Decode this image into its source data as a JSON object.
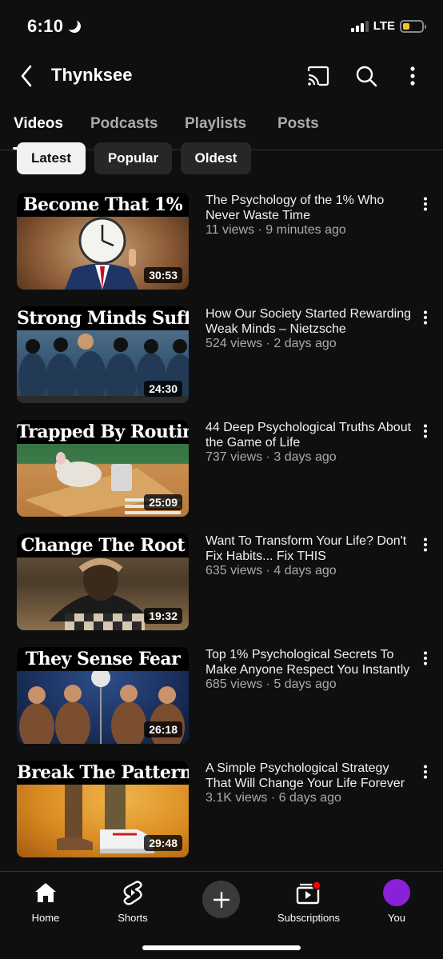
{
  "status_bar": {
    "time": "6:10",
    "network": "LTE",
    "battery_percent": 35
  },
  "header": {
    "channel_name": "Thynksee"
  },
  "tabs": [
    {
      "label": "Videos",
      "active": true
    },
    {
      "label": "Podcasts",
      "active": false
    },
    {
      "label": "Playlists",
      "active": false
    },
    {
      "label": "Posts",
      "active": false
    }
  ],
  "chips": [
    {
      "label": "Latest",
      "active": true
    },
    {
      "label": "Popular",
      "active": false
    },
    {
      "label": "Oldest",
      "active": false
    }
  ],
  "videos": [
    {
      "thumb_title": "Become That 1%",
      "duration": "30:53",
      "title": "The Psychology of the 1% Who Never Waste Time",
      "meta": "11 views · 9 minutes ago"
    },
    {
      "thumb_title": "Strong Minds Suffer",
      "duration": "24:30",
      "title": "How Our Society Started Rewarding Weak Minds – Nietzsche",
      "meta": "524 views · 2 days ago"
    },
    {
      "thumb_title": "Trapped By Routine",
      "duration": "25:09",
      "title": "44 Deep Psychological Truths About the Game of Life",
      "meta": "737 views · 3 days ago"
    },
    {
      "thumb_title": "Change The Root",
      "duration": "19:32",
      "title": "Want To Transform Your Life? Don't Fix Habits... Fix THIS",
      "meta": "635 views · 4 days ago"
    },
    {
      "thumb_title": "They Sense Fear",
      "duration": "26:18",
      "title": "Top 1% Psychological Secrets To Make Anyone Respect You Instantly",
      "meta": "685 views · 5 days ago"
    },
    {
      "thumb_title": "Break The Pattern",
      "duration": "29:48",
      "title": "A Simple Psychological Strategy That Will Change Your Life Forever",
      "meta": "3.1K views · 6 days ago"
    }
  ],
  "bottom_nav": [
    {
      "label": "Home",
      "icon": "home-icon"
    },
    {
      "label": "Shorts",
      "icon": "shorts-icon"
    },
    {
      "label": "",
      "icon": "create-icon"
    },
    {
      "label": "Subscriptions",
      "icon": "subscriptions-icon"
    },
    {
      "label": "You",
      "icon": "avatar"
    }
  ],
  "colors": {
    "background": "#0f0f0f",
    "accent_avatar": "#8a20d9",
    "notification_dot": "#ff0000",
    "battery": "#f5c518"
  }
}
